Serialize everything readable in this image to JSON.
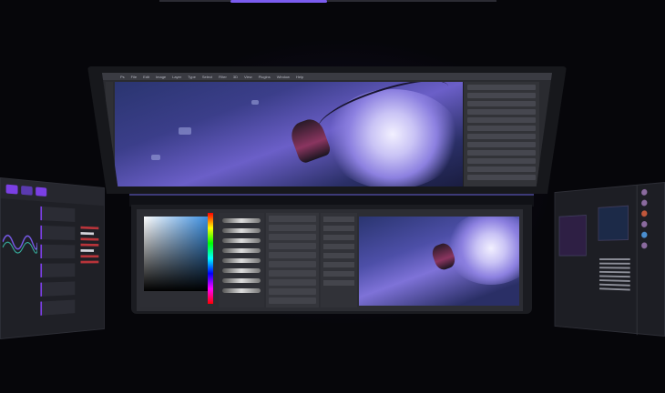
{
  "topbar": {
    "accent": "#7b5cf0"
  },
  "laptop": {
    "top_screen": {
      "app": "image-editor",
      "menu_items": [
        "Ps",
        "File",
        "Edit",
        "Image",
        "Layer",
        "Type",
        "Select",
        "Filter",
        "3D",
        "View",
        "Plugins",
        "Window",
        "Help"
      ]
    },
    "bottom_screen": {
      "panels": [
        "color-picker",
        "brush-presets",
        "layers",
        "properties",
        "canvas-preview"
      ]
    }
  },
  "left_panel": {
    "icons": [
      "waveform-icon",
      "list-icon"
    ],
    "accent": "#7b3fe4",
    "red_text_color": "#b8343a"
  },
  "right_panel": {
    "icons": [
      "avatar-icon"
    ]
  },
  "colors": {
    "accent": "#7b5cf0",
    "background": "#06060a",
    "panel": "#2c2d33"
  }
}
